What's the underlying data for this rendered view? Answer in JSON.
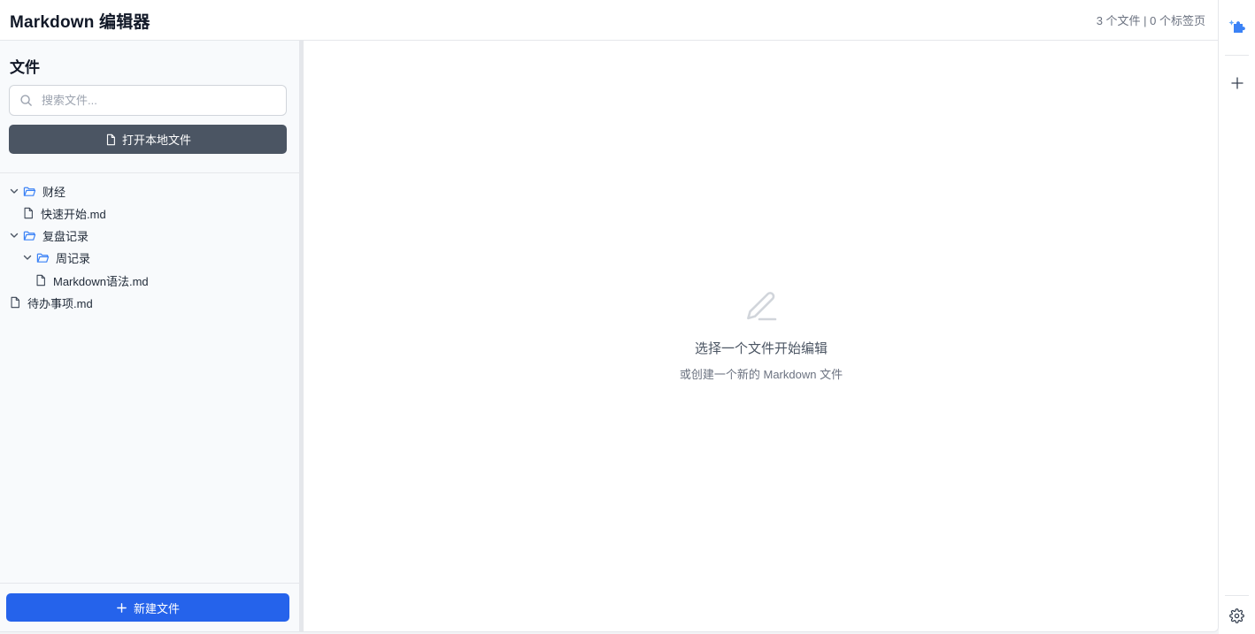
{
  "header": {
    "title": "Markdown 编辑器",
    "stats": "3 个文件 | 0 个标签页"
  },
  "sidebar": {
    "heading": "文件",
    "search": {
      "placeholder": "搜索文件...",
      "value": ""
    },
    "open_local_label": "打开本地文件",
    "new_file_label": "新建文件",
    "tree": [
      {
        "kind": "folder",
        "label": "财经",
        "expanded": true,
        "depth": 0
      },
      {
        "kind": "file",
        "label": "快速开始.md",
        "depth": 1
      },
      {
        "kind": "folder",
        "label": "复盘记录",
        "expanded": true,
        "depth": 0
      },
      {
        "kind": "folder",
        "label": "周记录",
        "expanded": true,
        "depth": 1
      },
      {
        "kind": "file",
        "label": "Markdown语法.md",
        "depth": 2
      },
      {
        "kind": "file",
        "label": "待办事项.md",
        "depth": 0
      }
    ]
  },
  "editor": {
    "empty_title": "选择一个文件开始编辑",
    "empty_subtitle": "或创建一个新的 Markdown 文件"
  },
  "colors": {
    "primary": "#2563eb",
    "secondary_button": "#4b5563",
    "folder_icon": "#3b82f6",
    "sidebar_bg": "#f8fafc"
  },
  "icons": {
    "right_toolbar": [
      "extension-puzzle-icon",
      "plus-icon",
      "gear-icon"
    ]
  }
}
